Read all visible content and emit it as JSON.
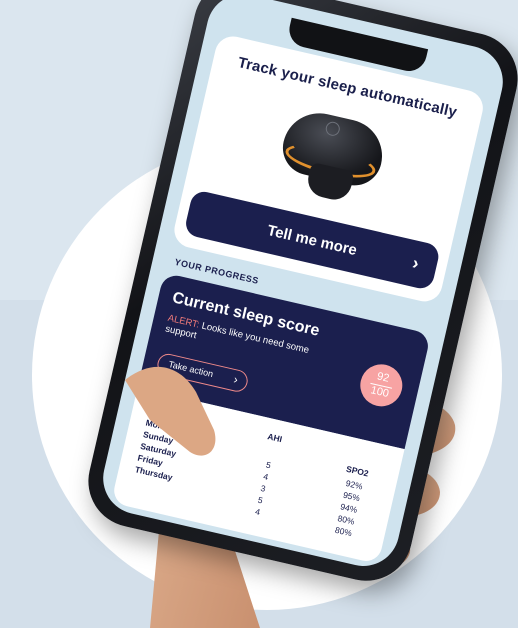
{
  "promo": {
    "title": "Track your sleep automatically",
    "button_label": "Tell me more",
    "button_icon": "chevron-right-icon"
  },
  "progress": {
    "section_label": "YOUR PROGRESS",
    "score_heading": "Current sleep score",
    "alert_prefix": "ALERT:",
    "alert_text": " Looks like you need some support",
    "action_label": "Take action",
    "score_value": "92",
    "score_max": "100"
  },
  "table": {
    "headers": {
      "day": "",
      "ahi": "AHI",
      "spo2": "SPO2"
    },
    "days": [
      "Monday",
      "Sunday",
      "Saturday",
      "Friday",
      "Thursday"
    ],
    "ahi": [
      "5",
      "4",
      "3",
      "5",
      "4"
    ],
    "spo2": [
      "92%",
      "95%",
      "94%",
      "80%",
      "80%"
    ]
  },
  "colors": {
    "navy": "#1b1f4e",
    "alert": "#f07a7a",
    "badge": "#f7a3a3",
    "accent_ring": "#e0902d"
  }
}
